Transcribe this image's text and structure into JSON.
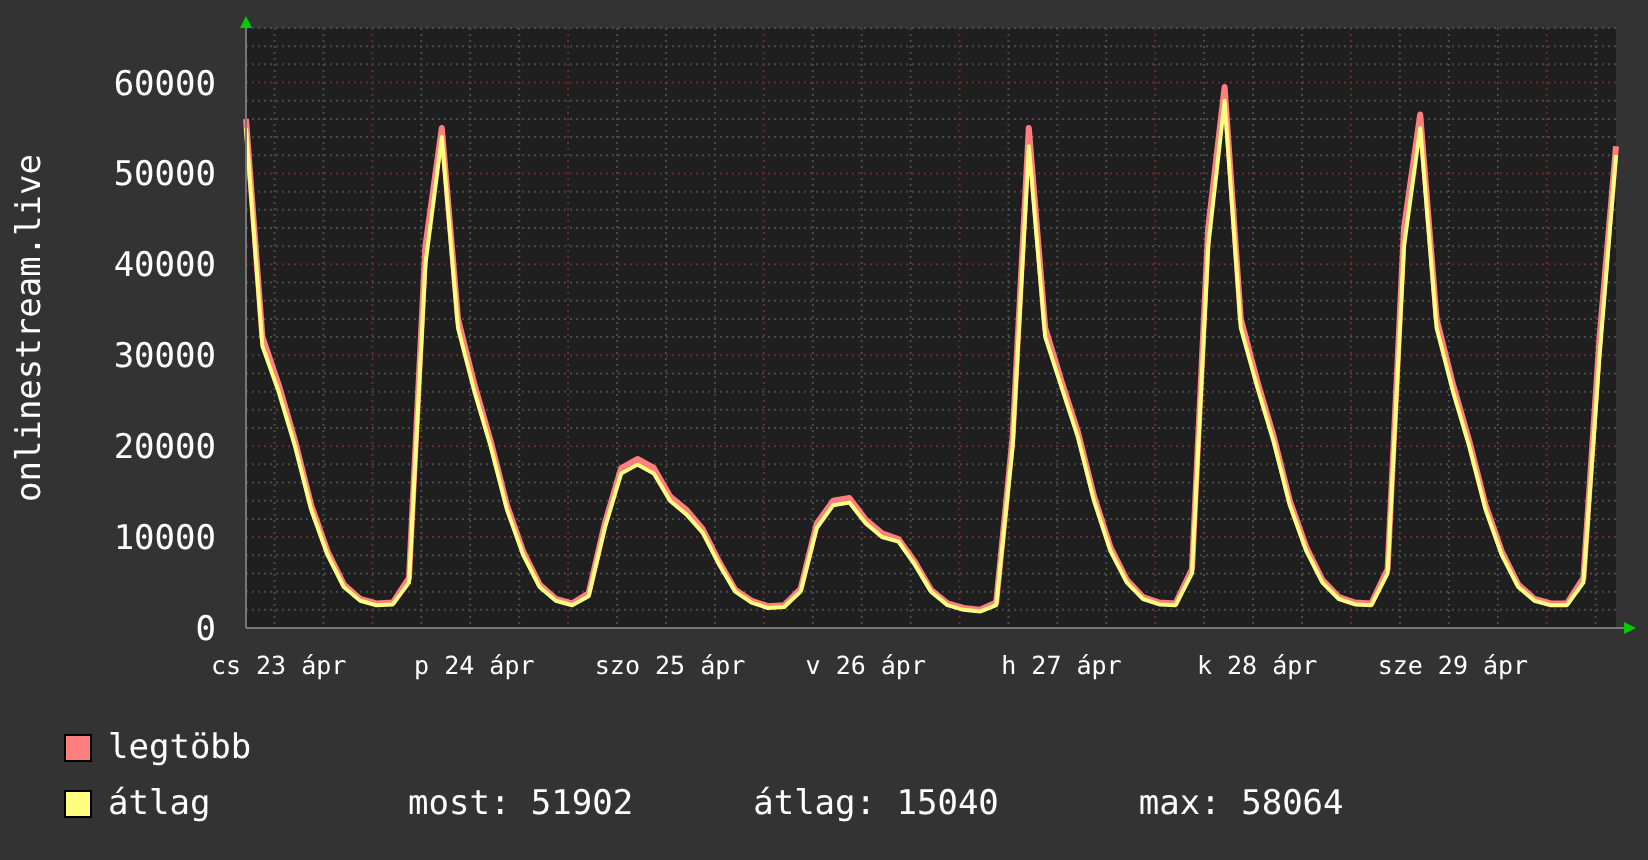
{
  "chart": {
    "chart_data": {
      "type": "line",
      "ylabel": "onlinestream.live",
      "ylim": [
        0,
        66000
      ],
      "grid": true,
      "yticks": [
        0,
        10000,
        20000,
        30000,
        40000,
        50000,
        60000
      ],
      "categories": [
        null,
        null,
        "cs 23 ápr",
        null,
        null,
        null,
        null,
        null,
        null,
        null,
        null,
        null,
        null,
        null,
        "p 24 ápr",
        null,
        null,
        null,
        null,
        null,
        null,
        null,
        null,
        null,
        null,
        null,
        "szo 25 ápr",
        null,
        null,
        null,
        null,
        null,
        null,
        null,
        null,
        null,
        null,
        null,
        "v 26 ápr",
        null,
        null,
        null,
        null,
        null,
        null,
        null,
        null,
        null,
        null,
        null,
        "h 27 ápr",
        null,
        null,
        null,
        null,
        null,
        null,
        null,
        null,
        null,
        null,
        null,
        "k 28 ápr",
        null,
        null,
        null,
        null,
        null,
        null,
        null,
        null,
        null,
        null,
        null,
        "sze 29 ápr",
        null,
        null,
        null,
        null,
        null,
        null,
        null,
        null,
        null,
        null
      ],
      "series": [
        {
          "name": "legtöbb",
          "color": "#ff7f7f",
          "values": [
            56000,
            32000,
            26800,
            20600,
            13500,
            8400,
            4800,
            3200,
            2700,
            2800,
            5500,
            42000,
            55000,
            34000,
            26800,
            20600,
            13500,
            8400,
            4800,
            3200,
            2700,
            3800,
            11500,
            17600,
            18600,
            17600,
            14500,
            13000,
            10900,
            7300,
            4200,
            3000,
            2400,
            2500,
            4300,
            11500,
            14000,
            14300,
            11900,
            10400,
            9800,
            7300,
            4200,
            2700,
            2200,
            2000,
            2800,
            21000,
            55000,
            33000,
            27200,
            21600,
            14500,
            8900,
            5300,
            3400,
            2800,
            2700,
            6500,
            44000,
            59500,
            34000,
            27200,
            21100,
            14000,
            8900,
            5300,
            3400,
            2800,
            2700,
            6500,
            44000,
            56500,
            34000,
            26800,
            20600,
            13500,
            8400,
            4800,
            3200,
            2700,
            2700,
            5500,
            32000,
            53000
          ]
        },
        {
          "name": "átlag",
          "color": "#ffff80",
          "values": [
            55000,
            31000,
            26000,
            20000,
            13000,
            8000,
            4500,
            3000,
            2500,
            2600,
            5000,
            40000,
            54000,
            33000,
            26000,
            20000,
            13000,
            8000,
            4500,
            3000,
            2500,
            3500,
            11000,
            17000,
            18000,
            17000,
            14000,
            12500,
            10500,
            7000,
            4000,
            2800,
            2200,
            2300,
            4000,
            11000,
            13500,
            13800,
            11500,
            10000,
            9500,
            7000,
            4000,
            2500,
            2000,
            1800,
            2500,
            20000,
            53000,
            32000,
            26500,
            21000,
            14000,
            8500,
            5000,
            3200,
            2600,
            2500,
            6000,
            42000,
            58000,
            33000,
            26500,
            20500,
            13500,
            8500,
            5000,
            3200,
            2600,
            2500,
            6000,
            42000,
            55000,
            33000,
            26000,
            20000,
            13000,
            8000,
            4500,
            3000,
            2500,
            2500,
            5000,
            30000,
            52000
          ]
        }
      ]
    }
  },
  "legend_stats": [
    "most: 51902",
    "átlag: 15040",
    "max: 58064"
  ]
}
